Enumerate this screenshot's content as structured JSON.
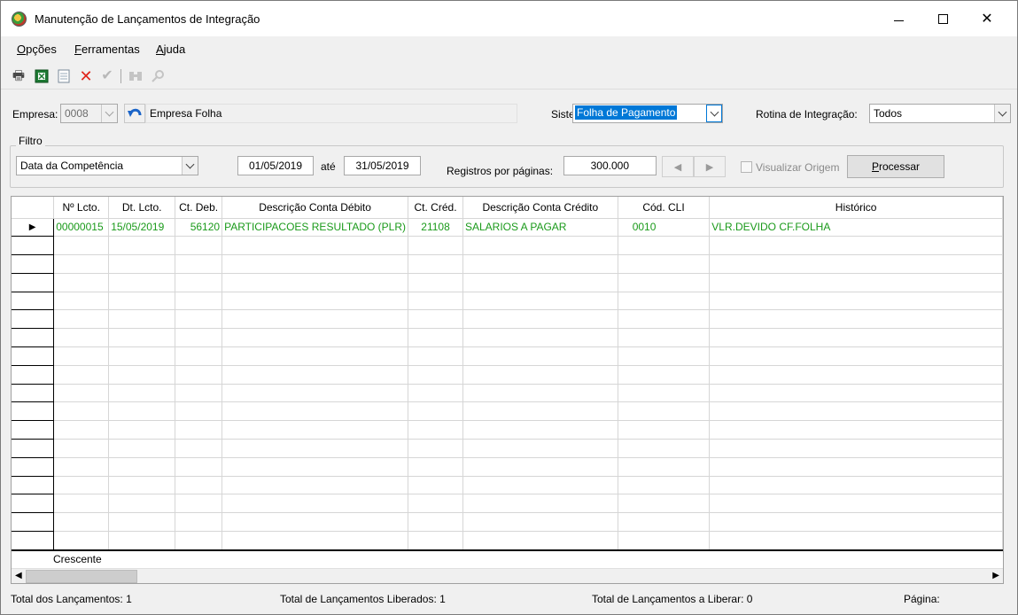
{
  "window": {
    "title": "Manutenção de Lançamentos de Integração"
  },
  "menu": {
    "items": [
      "Opções",
      "Ferramentas",
      "Ajuda"
    ]
  },
  "form": {
    "empresa_label": "Empresa:",
    "empresa_code": "0008",
    "empresa_name": "Empresa Folha",
    "sistema_label": "Sistema:",
    "sistema_value": "Folha de Pagamento",
    "rotina_label": "Rotina de Integração:",
    "rotina_value": "Todos"
  },
  "filter": {
    "legend": "Filtro",
    "type_value": "Data da Competência",
    "date_from": "01/05/2019",
    "ate_label": "até",
    "date_to": "31/05/2019",
    "registros_label": "Registros por páginas:",
    "registros_value": "300.000",
    "visualizar_label": "Visualizar Origem",
    "processar_label": "Processar"
  },
  "grid": {
    "columns": [
      "Nº Lcto.",
      "Dt. Lcto.",
      "Ct. Deb.",
      "Descrição Conta Débito",
      "Ct. Créd.",
      "Descrição Conta Crédito",
      "Cód. CLI",
      "Histórico"
    ],
    "rows": [
      [
        "00000015",
        "15/05/2019",
        "56120",
        "PARTICIPACOES RESULTADO (PLR)",
        "21108",
        "SALARIOS A PAGAR",
        "0010",
        "VLR.DEVIDO CF.FOLHA"
      ]
    ],
    "text_color": "#1a9a1a",
    "footer_label": "Crescente"
  },
  "status": {
    "total": "Total dos Lançamentos: 1",
    "liberados": "Total de Lançamentos Liberados: 1",
    "a_liberar": "Total de Lançamentos a Liberar: 0",
    "pagina": "Página:"
  }
}
